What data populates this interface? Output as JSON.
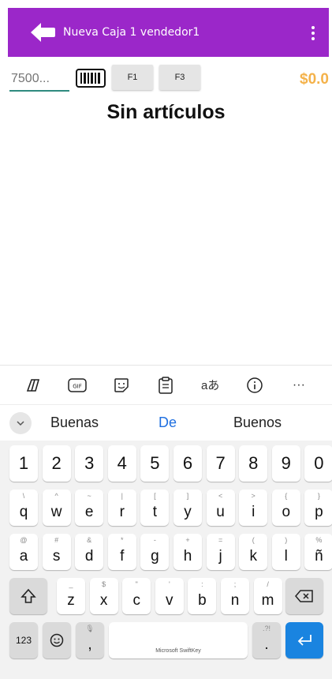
{
  "header": {
    "title": "Nueva Caja 1 vendedor1",
    "bg_color": "#9b27c9"
  },
  "toolbar": {
    "code_placeholder": "7500...",
    "f1_label": "F1",
    "f3_label": "F3",
    "total": "$0.0"
  },
  "content": {
    "empty_message": "Sin artículos"
  },
  "keyboard": {
    "suggestions": [
      "Buenas",
      "De",
      "Buenos"
    ],
    "number_row": [
      "1",
      "2",
      "3",
      "4",
      "5",
      "6",
      "7",
      "8",
      "9",
      "0"
    ],
    "row1": [
      {
        "key": "q",
        "alt": "\\"
      },
      {
        "key": "w",
        "alt": "^"
      },
      {
        "key": "e",
        "alt": "~"
      },
      {
        "key": "r",
        "alt": "|"
      },
      {
        "key": "t",
        "alt": "["
      },
      {
        "key": "y",
        "alt": "]"
      },
      {
        "key": "u",
        "alt": "<"
      },
      {
        "key": "i",
        "alt": ">"
      },
      {
        "key": "o",
        "alt": "{"
      },
      {
        "key": "p",
        "alt": "}"
      }
    ],
    "row2": [
      {
        "key": "a",
        "alt": "@"
      },
      {
        "key": "s",
        "alt": "#"
      },
      {
        "key": "d",
        "alt": "&"
      },
      {
        "key": "f",
        "alt": "*"
      },
      {
        "key": "g",
        "alt": "-"
      },
      {
        "key": "h",
        "alt": "+"
      },
      {
        "key": "j",
        "alt": "="
      },
      {
        "key": "k",
        "alt": "("
      },
      {
        "key": "l",
        "alt": ")"
      },
      {
        "key": "ñ",
        "alt": "%"
      }
    ],
    "row3": [
      {
        "key": "z",
        "alt": "_"
      },
      {
        "key": "x",
        "alt": "$"
      },
      {
        "key": "c",
        "alt": "\""
      },
      {
        "key": "v",
        "alt": "'"
      },
      {
        "key": "b",
        "alt": ":"
      },
      {
        "key": "n",
        "alt": ";"
      },
      {
        "key": "m",
        "alt": "/"
      }
    ],
    "bottom": {
      "numbers_label": "123",
      "comma": ",",
      "space_label": "Microsoft SwiftKey",
      "period": ".",
      "period_alt": ".?!"
    },
    "enter_color": "#1a84e0"
  }
}
